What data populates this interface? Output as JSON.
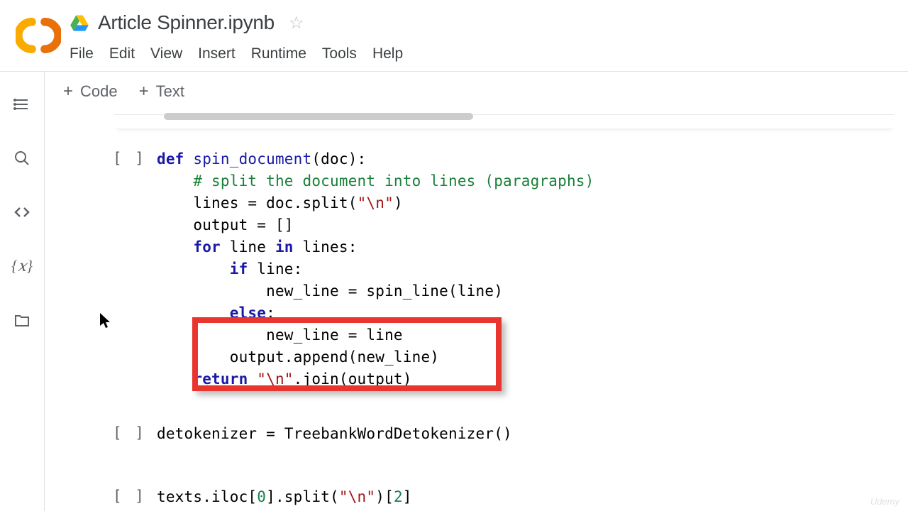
{
  "header": {
    "title": "Article Spinner.ipynb",
    "menus": [
      "File",
      "Edit",
      "View",
      "Insert",
      "Runtime",
      "Tools",
      "Help"
    ]
  },
  "toolbar": {
    "code_label": "Code",
    "text_label": "Text"
  },
  "sidebar_icons": [
    "toc",
    "search",
    "snippets",
    "vars",
    "files"
  ],
  "cells": [
    {
      "gutter": "[ ]",
      "lines": [
        [
          {
            "t": "def ",
            "c": "kw"
          },
          {
            "t": "spin_document",
            "c": "fn"
          },
          {
            "t": "(doc):",
            "c": ""
          }
        ],
        [
          {
            "t": "    ",
            "c": ""
          },
          {
            "t": "# split the document into lines (paragraphs)",
            "c": "cm"
          }
        ],
        [
          {
            "t": "    lines = doc.split(",
            "c": ""
          },
          {
            "t": "\"\\n\"",
            "c": "st"
          },
          {
            "t": ")",
            "c": ""
          }
        ],
        [
          {
            "t": "    output = []",
            "c": ""
          }
        ],
        [
          {
            "t": "    ",
            "c": ""
          },
          {
            "t": "for",
            "c": "kw"
          },
          {
            "t": " line ",
            "c": ""
          },
          {
            "t": "in",
            "c": "kw"
          },
          {
            "t": " lines:",
            "c": ""
          }
        ],
        [
          {
            "t": "        ",
            "c": ""
          },
          {
            "t": "if",
            "c": "kw"
          },
          {
            "t": " line:",
            "c": ""
          }
        ],
        [
          {
            "t": "            new_line = spin_line(line)",
            "c": ""
          }
        ],
        [
          {
            "t": "        ",
            "c": ""
          },
          {
            "t": "else",
            "c": "kw"
          },
          {
            "t": ":",
            "c": ""
          }
        ],
        [
          {
            "t": "            new_line = line",
            "c": ""
          }
        ],
        [
          {
            "t": "        output.append(new_line)",
            "c": ""
          }
        ],
        [
          {
            "t": "    ",
            "c": ""
          },
          {
            "t": "return",
            "c": "kw"
          },
          {
            "t": " ",
            "c": ""
          },
          {
            "t": "\"\\n\"",
            "c": "st"
          },
          {
            "t": ".join(output)",
            "c": ""
          }
        ]
      ]
    },
    {
      "gutter": "[ ]",
      "lines": [
        [
          {
            "t": "detokenizer = TreebankWordDetokenizer()",
            "c": ""
          }
        ]
      ]
    },
    {
      "gutter": "[ ]",
      "lines": [
        [
          {
            "t": "texts.iloc[",
            "c": ""
          },
          {
            "t": "0",
            "c": "num"
          },
          {
            "t": "].split(",
            "c": ""
          },
          {
            "t": "\"\\n\"",
            "c": "st"
          },
          {
            "t": ")[",
            "c": ""
          },
          {
            "t": "2",
            "c": "num"
          },
          {
            "t": "]",
            "c": ""
          }
        ]
      ]
    }
  ],
  "watermark": "Udemy"
}
